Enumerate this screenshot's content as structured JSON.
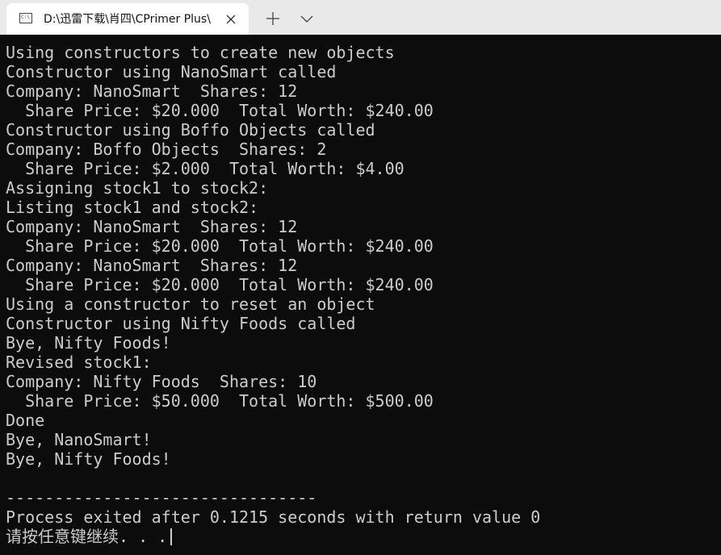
{
  "tab": {
    "title": "D:\\迅雷下载\\肖四\\CPrimer Plus\\",
    "icon": "console-app-icon"
  },
  "titlebar": {
    "close_icon": "close-icon",
    "new_tab_icon": "plus-icon",
    "dropdown_icon": "chevron-down-icon"
  },
  "console": {
    "lines": [
      "Using constructors to create new objects",
      "Constructor using NanoSmart called",
      "Company: NanoSmart  Shares: 12",
      "  Share Price: $20.000  Total Worth: $240.00",
      "Constructor using Boffo Objects called",
      "Company: Boffo Objects  Shares: 2",
      "  Share Price: $2.000  Total Worth: $4.00",
      "Assigning stock1 to stock2:",
      "Listing stock1 and stock2:",
      "Company: NanoSmart  Shares: 12",
      "  Share Price: $20.000  Total Worth: $240.00",
      "Company: NanoSmart  Shares: 12",
      "  Share Price: $20.000  Total Worth: $240.00",
      "Using a constructor to reset an object",
      "Constructor using Nifty Foods called",
      "Bye, Nifty Foods!",
      "Revised stock1:",
      "Company: Nifty Foods  Shares: 10",
      "  Share Price: $50.000  Total Worth: $500.00",
      "Done",
      "Bye, NanoSmart!",
      "Bye, Nifty Foods!",
      "",
      "--------------------------------",
      "Process exited after 0.1215 seconds with return value 0",
      "请按任意键继续. . ."
    ],
    "text_color": "#cccccc",
    "background_color": "#0c0c0c"
  }
}
